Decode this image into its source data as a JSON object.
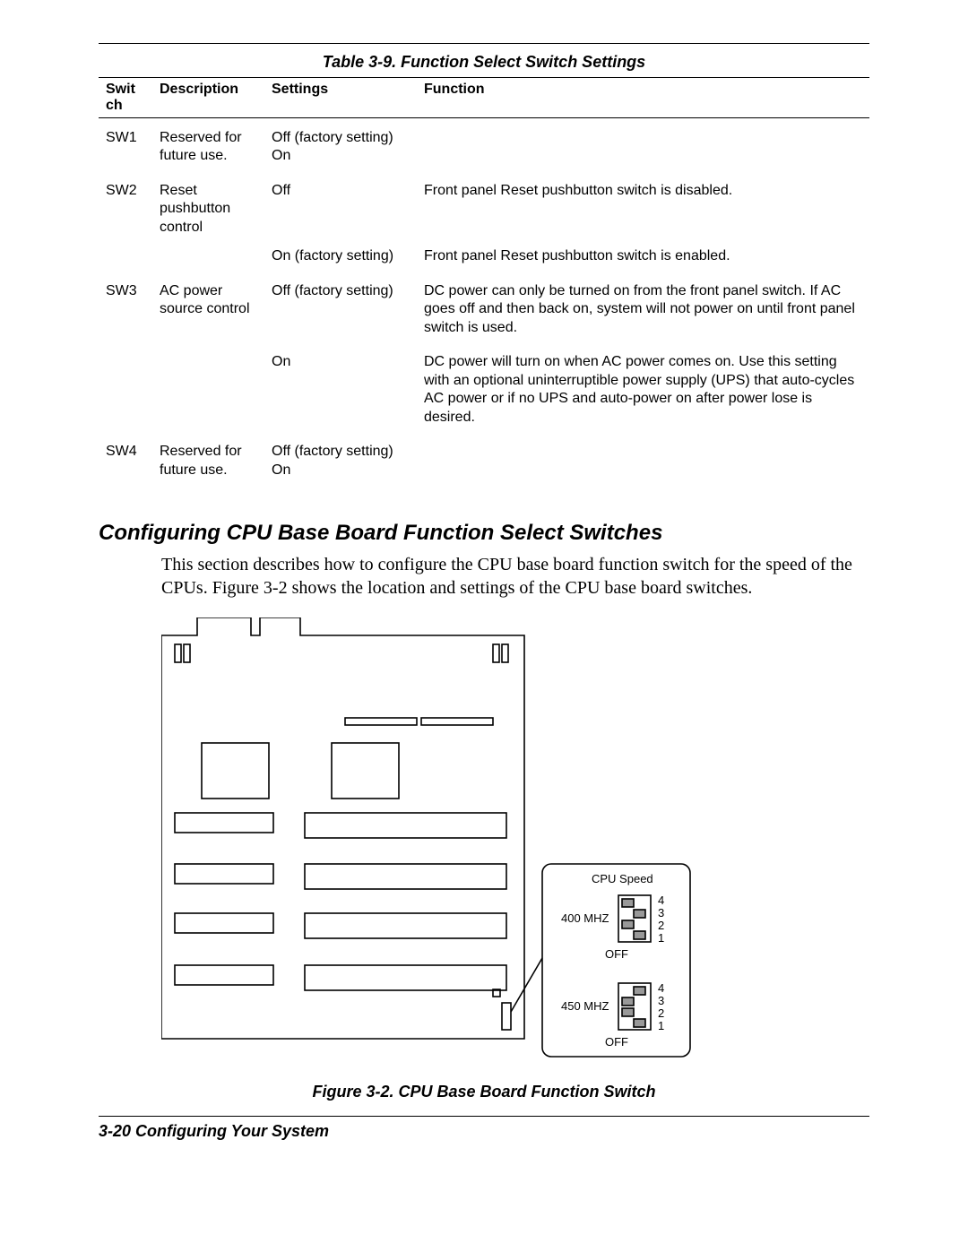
{
  "table": {
    "caption": "Table 3-9.  Function Select Switch Settings",
    "headers": {
      "switch": "Swit\nch",
      "description": "Description",
      "settings": "Settings",
      "function": "Function"
    },
    "rows": [
      {
        "switch": "SW1",
        "description": "Reserved for future use.",
        "settings": "Off (factory setting)\nOn",
        "function": ""
      },
      {
        "switch": "SW2",
        "description": "Reset pushbutton control",
        "settings": "Off",
        "function": "Front panel Reset pushbutton switch is disabled."
      },
      {
        "switch": "",
        "description": "",
        "settings": "On (factory setting)",
        "function": "Front panel Reset pushbutton switch is enabled."
      },
      {
        "switch": "SW3",
        "description": "AC power source control",
        "settings": "Off (factory setting)",
        "function": "DC power can only be turned on from the front panel switch. If AC goes off and then back on, system will not power on until front panel switch is used."
      },
      {
        "switch": "",
        "description": "",
        "settings": "On",
        "function": "DC power will turn on when AC power comes on. Use this setting with an optional uninterruptible power supply (UPS) that auto-cycles AC power or if no UPS and auto-power on after power lose is desired."
      },
      {
        "switch": "SW4",
        "description": "Reserved for future use.",
        "settings": "Off (factory setting)\nOn",
        "function": ""
      }
    ]
  },
  "section": {
    "heading": "Configuring CPU Base Board Function Select Switches",
    "body": "This section describes how to configure the CPU base board function switch for the speed of the CPUs. Figure 3-2 shows the location and settings of the CPU base board switches."
  },
  "figure": {
    "caption": "Figure 3-2.  CPU Base Board Function Switch",
    "labels": {
      "cpu_speed": "CPU Speed",
      "mhz400": "400 MHZ",
      "mhz450": "450 MHZ",
      "off": "OFF",
      "n1": "1",
      "n2": "2",
      "n3": "3",
      "n4": "4"
    }
  },
  "footer": "3-20   Configuring Your System"
}
